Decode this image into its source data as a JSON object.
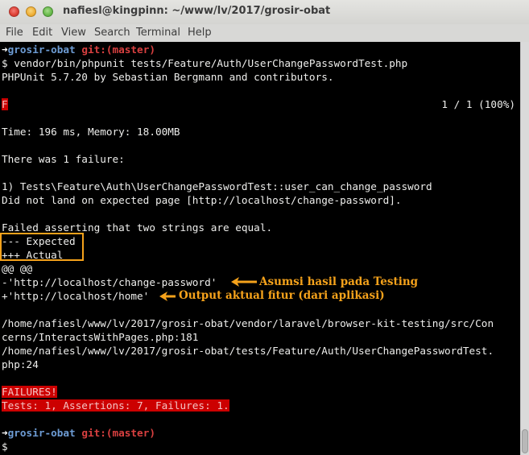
{
  "window": {
    "title": "nafiesl@kingpinn: ~/www/lv/2017/grosir-obat",
    "buttons": [
      "close",
      "minimize",
      "maximize"
    ]
  },
  "menu": [
    "File",
    "Edit",
    "View",
    "Search",
    "Terminal",
    "Help"
  ],
  "terminal": {
    "prompt1": {
      "arrow": "➜",
      "dir": "grosir-obat",
      "git": "git:(master)"
    },
    "command": "$ vendor/bin/phpunit tests/Feature/Auth/UserChangePasswordTest.php",
    "phpunit_header": "PHPUnit 5.7.20 by Sebastian Bergmann and contributors.",
    "progress_marker": "F",
    "progress_count": "1 / 1 (100%)",
    "time_memory": "Time: 196 ms, Memory: 18.00MB",
    "failure_count": "There was 1 failure:",
    "failure_test": "1) Tests\\Feature\\Auth\\UserChangePasswordTest::user_can_change_password",
    "failure_message": "Did not land on expected page [http://localhost/change-password].",
    "assert_message": "Failed asserting that two strings are equal.",
    "diff_expected": "--- Expected",
    "diff_actual": "+++ Actual",
    "diff_hunk": "@@ @@",
    "diff_minus": "-'http://localhost/change-password'",
    "diff_plus": "+'http://localhost/home'",
    "trace1a": "/home/nafiesl/www/lv/2017/grosir-obat/vendor/laravel/browser-kit-testing/src/Con",
    "trace1b": "cerns/InteractsWithPages.php:181",
    "trace2a": "/home/nafiesl/www/lv/2017/grosir-obat/tests/Feature/Auth/UserChangePasswordTest.",
    "trace2b": "php:24",
    "failures_title": "FAILURES!",
    "failures_summary": "Tests: 1, Assertions: 7, Failures: 1.",
    "prompt2": {
      "arrow": "➜",
      "dir": "grosir-obat",
      "git": "git:(master)"
    },
    "final_prompt": "$"
  },
  "annotations": {
    "expected_note": "Asumsi hasil pada Testing",
    "actual_note": "Output aktual fitur (dari aplikasi)",
    "color": "#f5a21b"
  }
}
